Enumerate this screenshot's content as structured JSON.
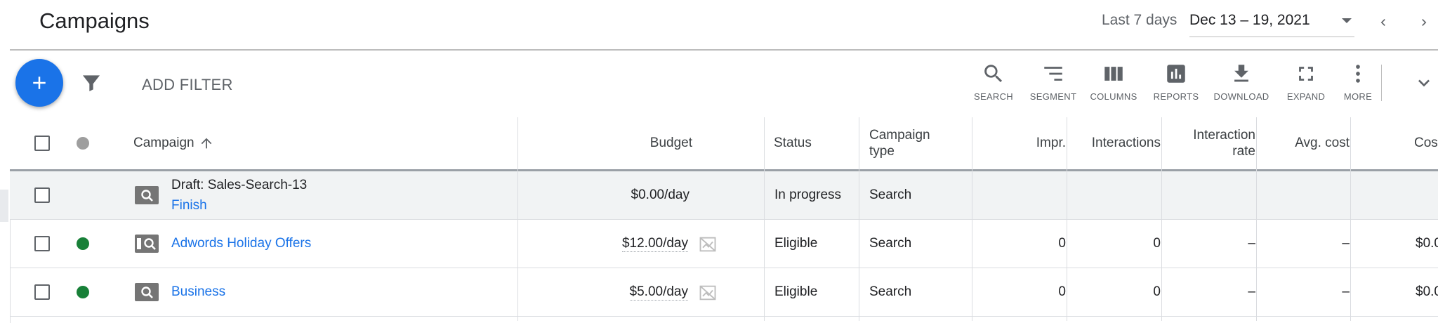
{
  "header": {
    "title": "Campaigns",
    "range_label": "Last 7 days",
    "range_value": "Dec 13 – 19, 2021"
  },
  "toolbar": {
    "add_filter": "ADD FILTER",
    "tools": {
      "search": "SEARCH",
      "segment": "SEGMENT",
      "columns": "COLUMNS",
      "reports": "REPORTS",
      "download": "DOWNLOAD",
      "expand": "EXPAND",
      "more": "MORE"
    }
  },
  "table": {
    "columns": {
      "campaign": "Campaign",
      "budget": "Budget",
      "status": "Status",
      "campaign_type_1": "Campaign",
      "campaign_type_2": "type",
      "impr": "Impr.",
      "interactions": "Interactions",
      "interaction_rate_1": "Interaction",
      "interaction_rate_2": "rate",
      "avg_cost": "Avg. cost",
      "cost": "Cos"
    },
    "rows": [
      {
        "name": "Draft: Sales-Search-13",
        "action": "Finish",
        "budget": "$0.00/day",
        "status": "In progress",
        "type": "Search",
        "impr": "",
        "interactions": "",
        "interaction_rate": "",
        "avg_cost": "",
        "cost": ""
      },
      {
        "name": "Adwords Holiday Offers",
        "budget": "$12.00/day",
        "status": "Eligible",
        "type": "Search",
        "impr": "0",
        "interactions": "0",
        "interaction_rate": "–",
        "avg_cost": "–",
        "cost": "$0.0"
      },
      {
        "name": "Business",
        "budget": "$5.00/day",
        "status": "Eligible",
        "type": "Search",
        "impr": "0",
        "interactions": "0",
        "interaction_rate": "–",
        "avg_cost": "–",
        "cost": "$0.0"
      }
    ]
  },
  "colors": {
    "accent": "#1a73e8",
    "status_enabled": "#188038",
    "status_header": "#9e9e9e"
  },
  "icons": [
    "plus-icon",
    "filter-icon",
    "search-icon",
    "segment-icon",
    "columns-icon",
    "reports-icon",
    "download-icon",
    "expand-icon",
    "more-icon",
    "chevron-down-icon",
    "chevron-left-icon",
    "chevron-right-icon",
    "arrow-up-icon",
    "search-campaign-icon",
    "budget-chart-icon"
  ]
}
